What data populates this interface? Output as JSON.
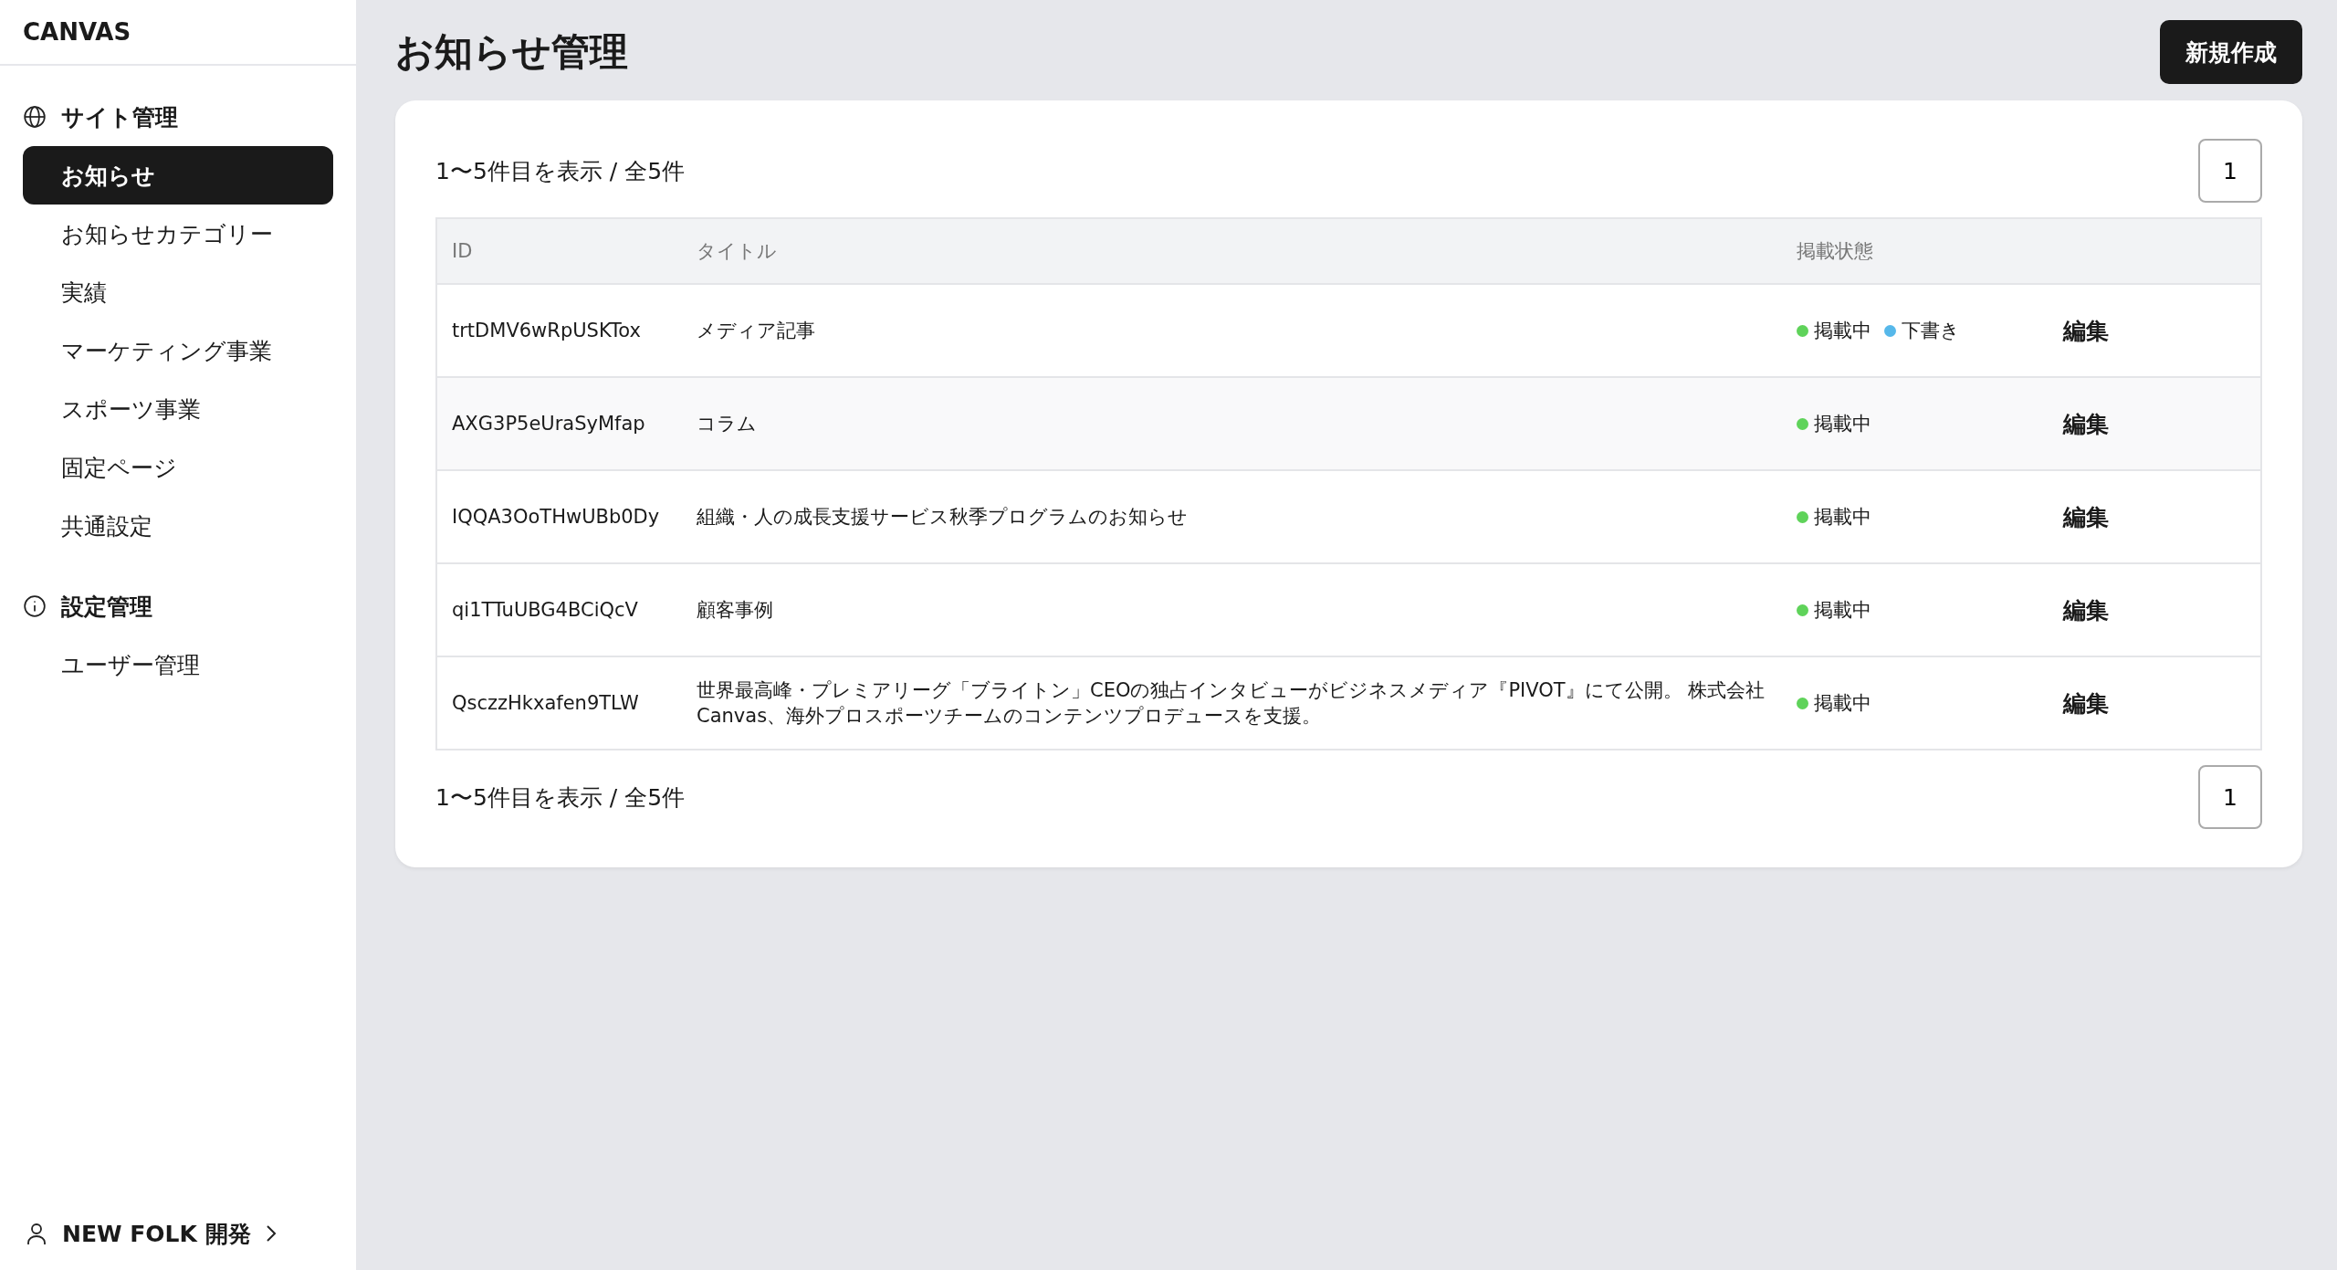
{
  "sidebar": {
    "logo": "CANVAS",
    "groups": [
      {
        "title": "サイト管理",
        "kind": "site",
        "items": [
          {
            "label": "お知らせ",
            "selected": true
          },
          {
            "label": "お知らせカテゴリー",
            "selected": false
          },
          {
            "label": "実績",
            "selected": false
          },
          {
            "label": "マーケティング事業",
            "selected": false
          },
          {
            "label": "スポーツ事業",
            "selected": false
          },
          {
            "label": "固定ページ",
            "selected": false
          },
          {
            "label": "共通設定",
            "selected": false
          }
        ]
      },
      {
        "title": "設定管理",
        "kind": "settings",
        "items": [
          {
            "label": "ユーザー管理",
            "selected": false
          }
        ]
      }
    ],
    "account": {
      "label": "NEW FOLK 開発"
    }
  },
  "page": {
    "title": "お知らせ管理",
    "new_button": "新規作成"
  },
  "pagination_top": {
    "summary": "1〜5件目を表示 / 全5件",
    "pages": [
      {
        "label": "1",
        "selected": true
      }
    ]
  },
  "table": {
    "columns": [
      "ID",
      "タイトル",
      "掲載状態"
    ],
    "rows": [
      {
        "id": "trtDMV6wRpUSKTox",
        "title": "メディア記事",
        "statuses": [
          {
            "label": "掲載中",
            "color": "#5fd35a"
          },
          {
            "label": "下書き",
            "color": "#56b8ea"
          }
        ],
        "action": "編集"
      },
      {
        "id": "AXG3P5eUraSyMfap",
        "title": "コラム",
        "statuses": [
          {
            "label": "掲載中",
            "color": "#5fd35a"
          }
        ],
        "action": "編集"
      },
      {
        "id": "IQQA3OoTHwUBb0Dy",
        "title": "組織・人の成長支援サービス秋季プログラムのお知らせ",
        "statuses": [
          {
            "label": "掲載中",
            "color": "#5fd35a"
          }
        ],
        "action": "編集"
      },
      {
        "id": "qi1TTuUBG4BCiQcV",
        "title": "顧客事例",
        "statuses": [
          {
            "label": "掲載中",
            "color": "#5fd35a"
          }
        ],
        "action": "編集"
      },
      {
        "id": "QsczzHkxafen9TLW",
        "title": "世界最高峰・プレミアリーグ「ブライトン」CEOの独占インタビューがビジネスメディア『PIVOT』にて公開。 株式会社Canvas、海外プロスポーツチームのコンテンツプロデュースを支援。",
        "statuses": [
          {
            "label": "掲載中",
            "color": "#5fd35a"
          }
        ],
        "action": "編集"
      }
    ]
  },
  "pagination_bottom": {
    "summary": "1〜5件目を表示 / 全5件",
    "pages": [
      {
        "label": "1",
        "selected": true
      }
    ]
  }
}
